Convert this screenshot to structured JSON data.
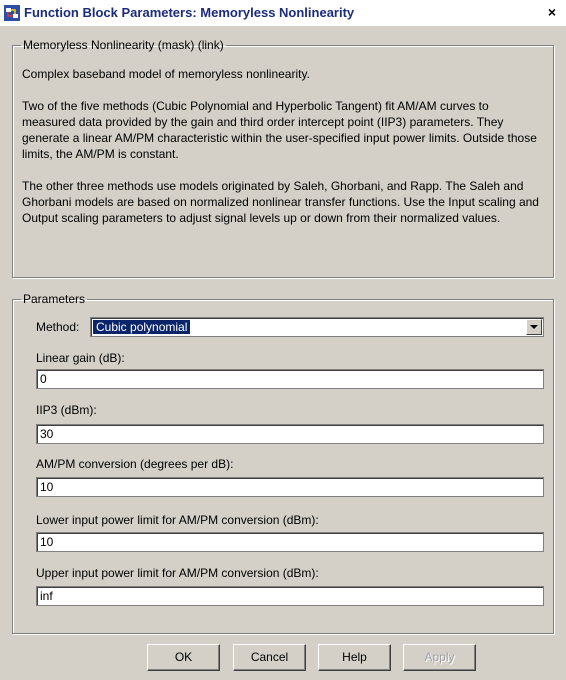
{
  "window": {
    "title": "Function Block Parameters: Memoryless Nonlinearity",
    "close_label": "×"
  },
  "mask": {
    "legend": "Memoryless Nonlinearity (mask) (link)",
    "description": [
      "Complex baseband model of memoryless nonlinearity.",
      "Two of the five methods (Cubic Polynomial and Hyperbolic Tangent) fit AM/AM curves to measured data provided by the gain and third order intercept point (IIP3) parameters.  They generate a linear AM/PM characteristic within the user-specified input power limits.  Outside those limits, the AM/PM is constant.",
      "The other three methods use models originated by Saleh, Ghorbani, and Rapp.  The Saleh and Ghorbani models are based on normalized nonlinear transfer functions. Use the Input scaling and Output scaling parameters to adjust signal levels up or down from their normalized values."
    ]
  },
  "parameters": {
    "legend": "Parameters",
    "method": {
      "label": "Method:",
      "value": "Cubic polynomial"
    },
    "linear_gain": {
      "label": "Linear gain (dB):",
      "value": "0"
    },
    "iip3": {
      "label": "IIP3 (dBm):",
      "value": "30"
    },
    "ampm_conversion": {
      "label": "AM/PM conversion (degrees per dB):",
      "value": "10"
    },
    "lower_limit": {
      "label": "Lower input power limit for AM/PM conversion (dBm):",
      "value": "10"
    },
    "upper_limit": {
      "label": "Upper input power limit for AM/PM conversion (dBm):",
      "value": "inf"
    }
  },
  "buttons": {
    "ok": "OK",
    "cancel": "Cancel",
    "help": "Help",
    "apply": "Apply"
  },
  "icons": {
    "title_icon": "simulink-block-icon",
    "close": "close-icon",
    "dropdown": "chevron-down-icon"
  },
  "colors": {
    "dialog_background": "#d4d0c8",
    "title_text": "#1c2b7a",
    "selection_highlight": "#0a246a"
  }
}
